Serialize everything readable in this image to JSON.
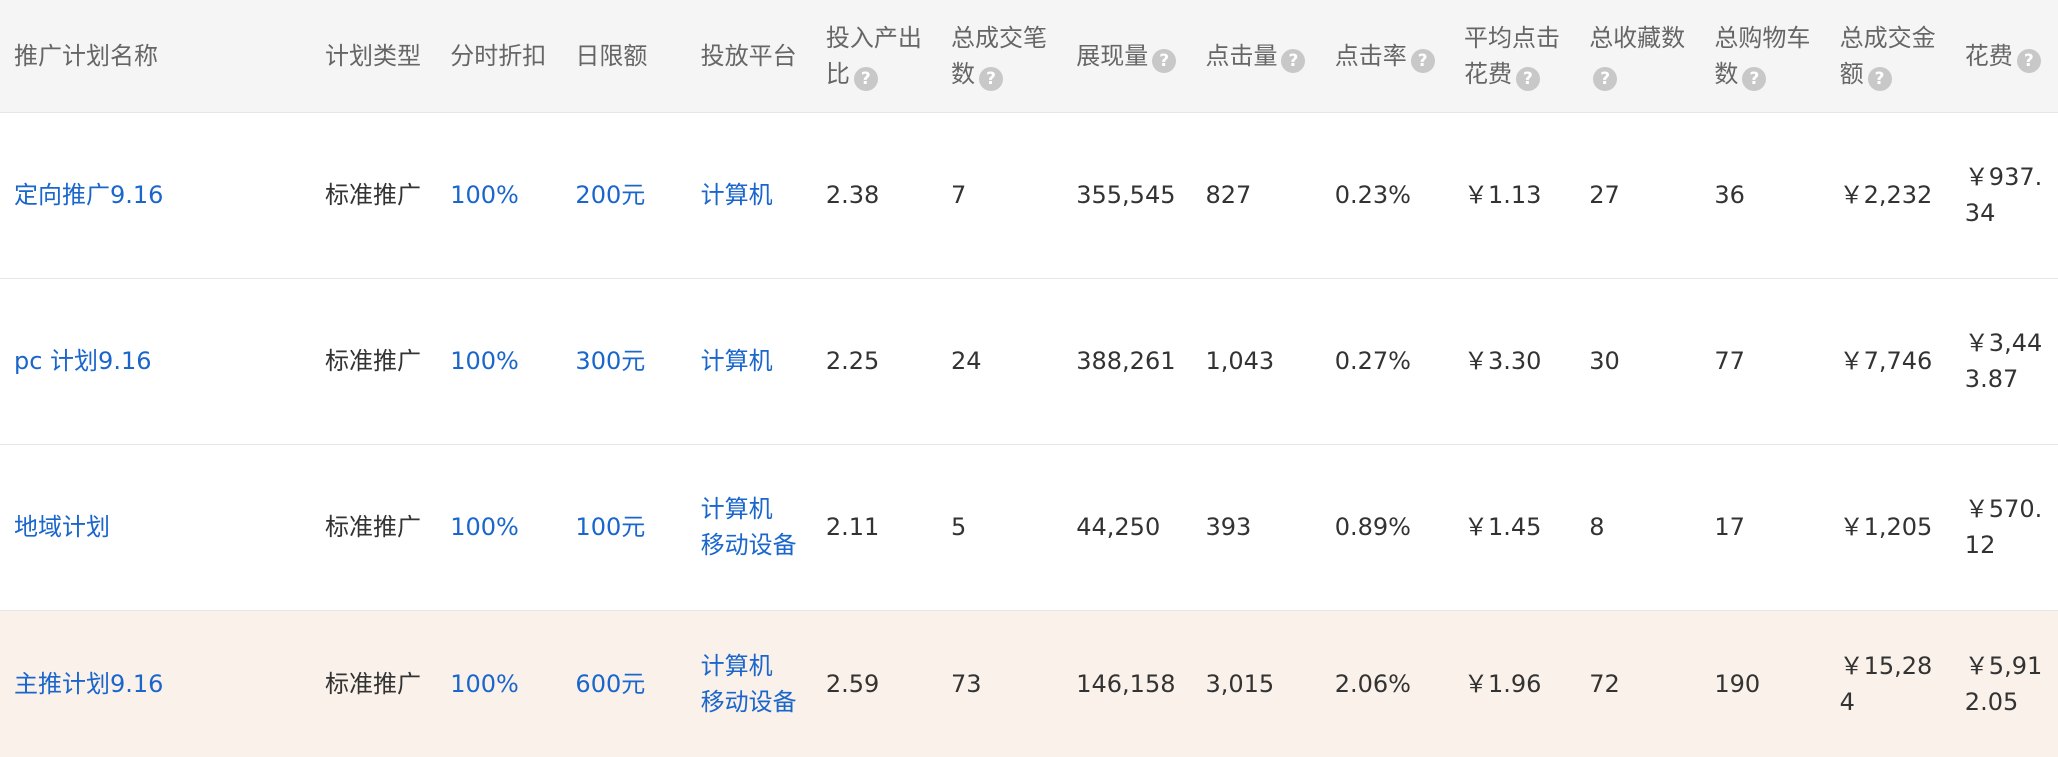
{
  "columns": [
    {
      "label": "推广计划名称",
      "help": false
    },
    {
      "label": "计划类型",
      "help": false
    },
    {
      "label": "分时折扣",
      "help": false
    },
    {
      "label": "日限额",
      "help": false
    },
    {
      "label": "投放平台",
      "help": false
    },
    {
      "label": "投入产出比",
      "help": true
    },
    {
      "label": "总成交笔数",
      "help": true
    },
    {
      "label": "展现量",
      "help": true
    },
    {
      "label": "点击量",
      "help": true
    },
    {
      "label": "点击率",
      "help": true
    },
    {
      "label": "平均点击花费",
      "help": true
    },
    {
      "label": "总收藏数",
      "help": true
    },
    {
      "label": "总购物车数",
      "help": true
    },
    {
      "label": "总成交金额",
      "help": true
    },
    {
      "label": "花费",
      "help": true
    }
  ],
  "help_icon": {
    "glyph": "?",
    "icon": "question-circle-icon"
  },
  "rows": [
    {
      "name": "定向推广9.16",
      "type": "标准推广",
      "discount": "100%",
      "daily_limit": "200元",
      "platforms": [
        "计算机"
      ],
      "roi": "2.38",
      "orders": "7",
      "impressions": "355,545",
      "clicks": "827",
      "ctr": "0.23%",
      "cpc": "￥1.13",
      "favorites": "27",
      "carts": "36",
      "gmv": "￥2,232",
      "cost": "￥937.34",
      "highlighted": false
    },
    {
      "name": "pc 计划9.16",
      "type": "标准推广",
      "discount": "100%",
      "daily_limit": "300元",
      "platforms": [
        "计算机"
      ],
      "roi": "2.25",
      "orders": "24",
      "impressions": "388,261",
      "clicks": "1,043",
      "ctr": "0.27%",
      "cpc": "￥3.30",
      "favorites": "30",
      "carts": "77",
      "gmv": "￥7,746",
      "cost": "￥3,443.87",
      "highlighted": false
    },
    {
      "name": "地域计划",
      "type": "标准推广",
      "discount": "100%",
      "daily_limit": "100元",
      "platforms": [
        "计算机",
        "移动设备"
      ],
      "roi": "2.11",
      "orders": "5",
      "impressions": "44,250",
      "clicks": "393",
      "ctr": "0.89%",
      "cpc": "￥1.45",
      "favorites": "8",
      "carts": "17",
      "gmv": "￥1,205",
      "cost": "￥570.12",
      "highlighted": false
    },
    {
      "name": "主推计划9.16",
      "type": "标准推广",
      "discount": "100%",
      "daily_limit": "600元",
      "platforms": [
        "计算机",
        "移动设备"
      ],
      "roi": "2.59",
      "orders": "73",
      "impressions": "146,158",
      "clicks": "3,015",
      "ctr": "2.06%",
      "cpc": "￥1.96",
      "favorites": "72",
      "carts": "190",
      "gmv": "￥15,284",
      "cost": "￥5,912.05",
      "highlighted": true
    }
  ],
  "colors": {
    "link": "#1a66cc",
    "header_bg": "#f5f5f5",
    "highlight_row_bg": "#f9f1ea",
    "help_icon_bg": "#c8c8c8"
  }
}
